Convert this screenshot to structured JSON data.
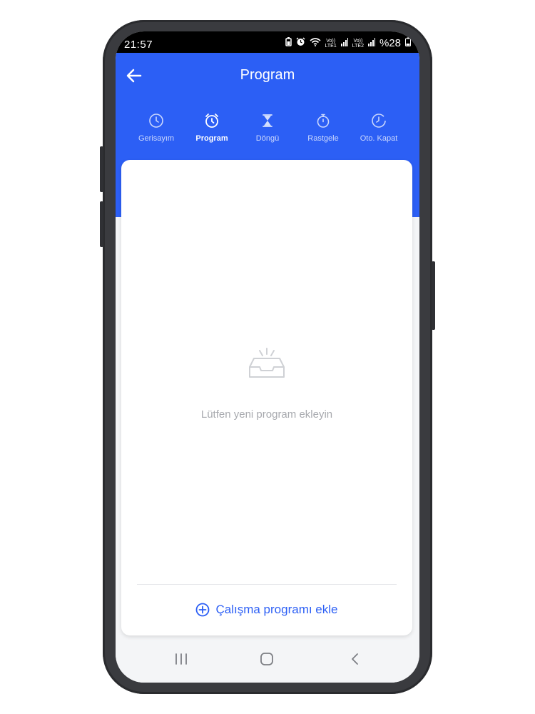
{
  "status_bar": {
    "time": "21:57",
    "battery": "%28",
    "sim1_carrier": "Vo))",
    "sim1_network": "LTE1",
    "sim2_carrier": "Vo))",
    "sim2_network": "LTE2",
    "icons": [
      "battery-saver-icon",
      "alarm-icon",
      "wifi-icon",
      "signal-icon",
      "signal-icon",
      "battery-icon"
    ]
  },
  "header": {
    "title": "Program",
    "back_icon": "arrow-left-icon",
    "background_color": "#2c5ff5"
  },
  "tabs": [
    {
      "label": "Gerisayım",
      "icon": "clock-icon",
      "active": false
    },
    {
      "label": "Program",
      "icon": "alarm-clock-icon",
      "active": true
    },
    {
      "label": "Döngü",
      "icon": "hourglass-icon",
      "active": false
    },
    {
      "label": "Rastgele",
      "icon": "stopwatch-icon",
      "active": false
    },
    {
      "label": "Oto. Kapat",
      "icon": "timer-off-icon",
      "active": false
    }
  ],
  "content": {
    "empty_icon": "empty-inbox-icon",
    "empty_message": "Lütfen yeni program ekleyin",
    "add_button_label": "Çalışma programı ekle",
    "add_button_icon": "plus-circle-icon",
    "accent_color": "#2c5ff5"
  },
  "nav_bar": {
    "icons": [
      "recent-apps-icon",
      "home-icon",
      "back-icon"
    ]
  }
}
